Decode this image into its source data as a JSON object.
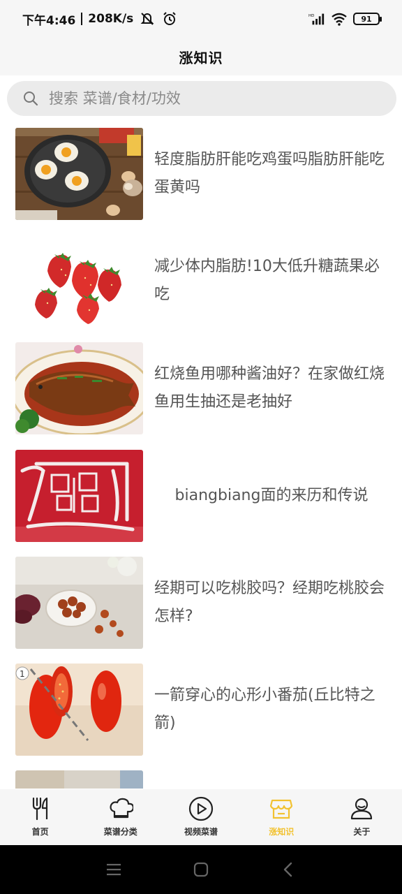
{
  "status_bar": {
    "time": "下午4:46",
    "speed": "208K/s",
    "battery": "91",
    "icons": [
      "mute-icon",
      "alarm-icon",
      "signal-icon",
      "wifi-icon",
      "battery-icon"
    ]
  },
  "header": {
    "title": "涨知识"
  },
  "search": {
    "placeholder": "搜索 菜谱/食材/功效"
  },
  "articles": [
    {
      "title": "轻度脂肪肝能吃鸡蛋吗脂肪肝能吃蛋黄吗",
      "thumb": "fried-eggs-image"
    },
    {
      "title": "减少体内脂肪!10大低升糖蔬果必吃",
      "thumb": "strawberries-image"
    },
    {
      "title": "红烧鱼用哪种酱油好？在家做红烧鱼用生抽还是老抽好",
      "thumb": "braised-fish-image"
    },
    {
      "title": "biangbiang面的来历和传说",
      "thumb": "biang-character-image"
    },
    {
      "title": "经期可以吃桃胶吗？经期吃桃胶会怎样?",
      "thumb": "peach-gum-image"
    },
    {
      "title": "一箭穿心的心形小番茄(丘比特之箭)",
      "thumb": "tomatoes-image"
    }
  ],
  "bottom_nav": {
    "items": [
      {
        "label": "首页",
        "icon": "fork-knife-icon"
      },
      {
        "label": "菜谱分类",
        "icon": "chef-hat-icon"
      },
      {
        "label": "视频菜谱",
        "icon": "play-icon"
      },
      {
        "label": "涨知识",
        "icon": "shop-icon"
      },
      {
        "label": "关于",
        "icon": "user-icon"
      }
    ],
    "active_index": 3,
    "active_color": "#f2c230"
  }
}
